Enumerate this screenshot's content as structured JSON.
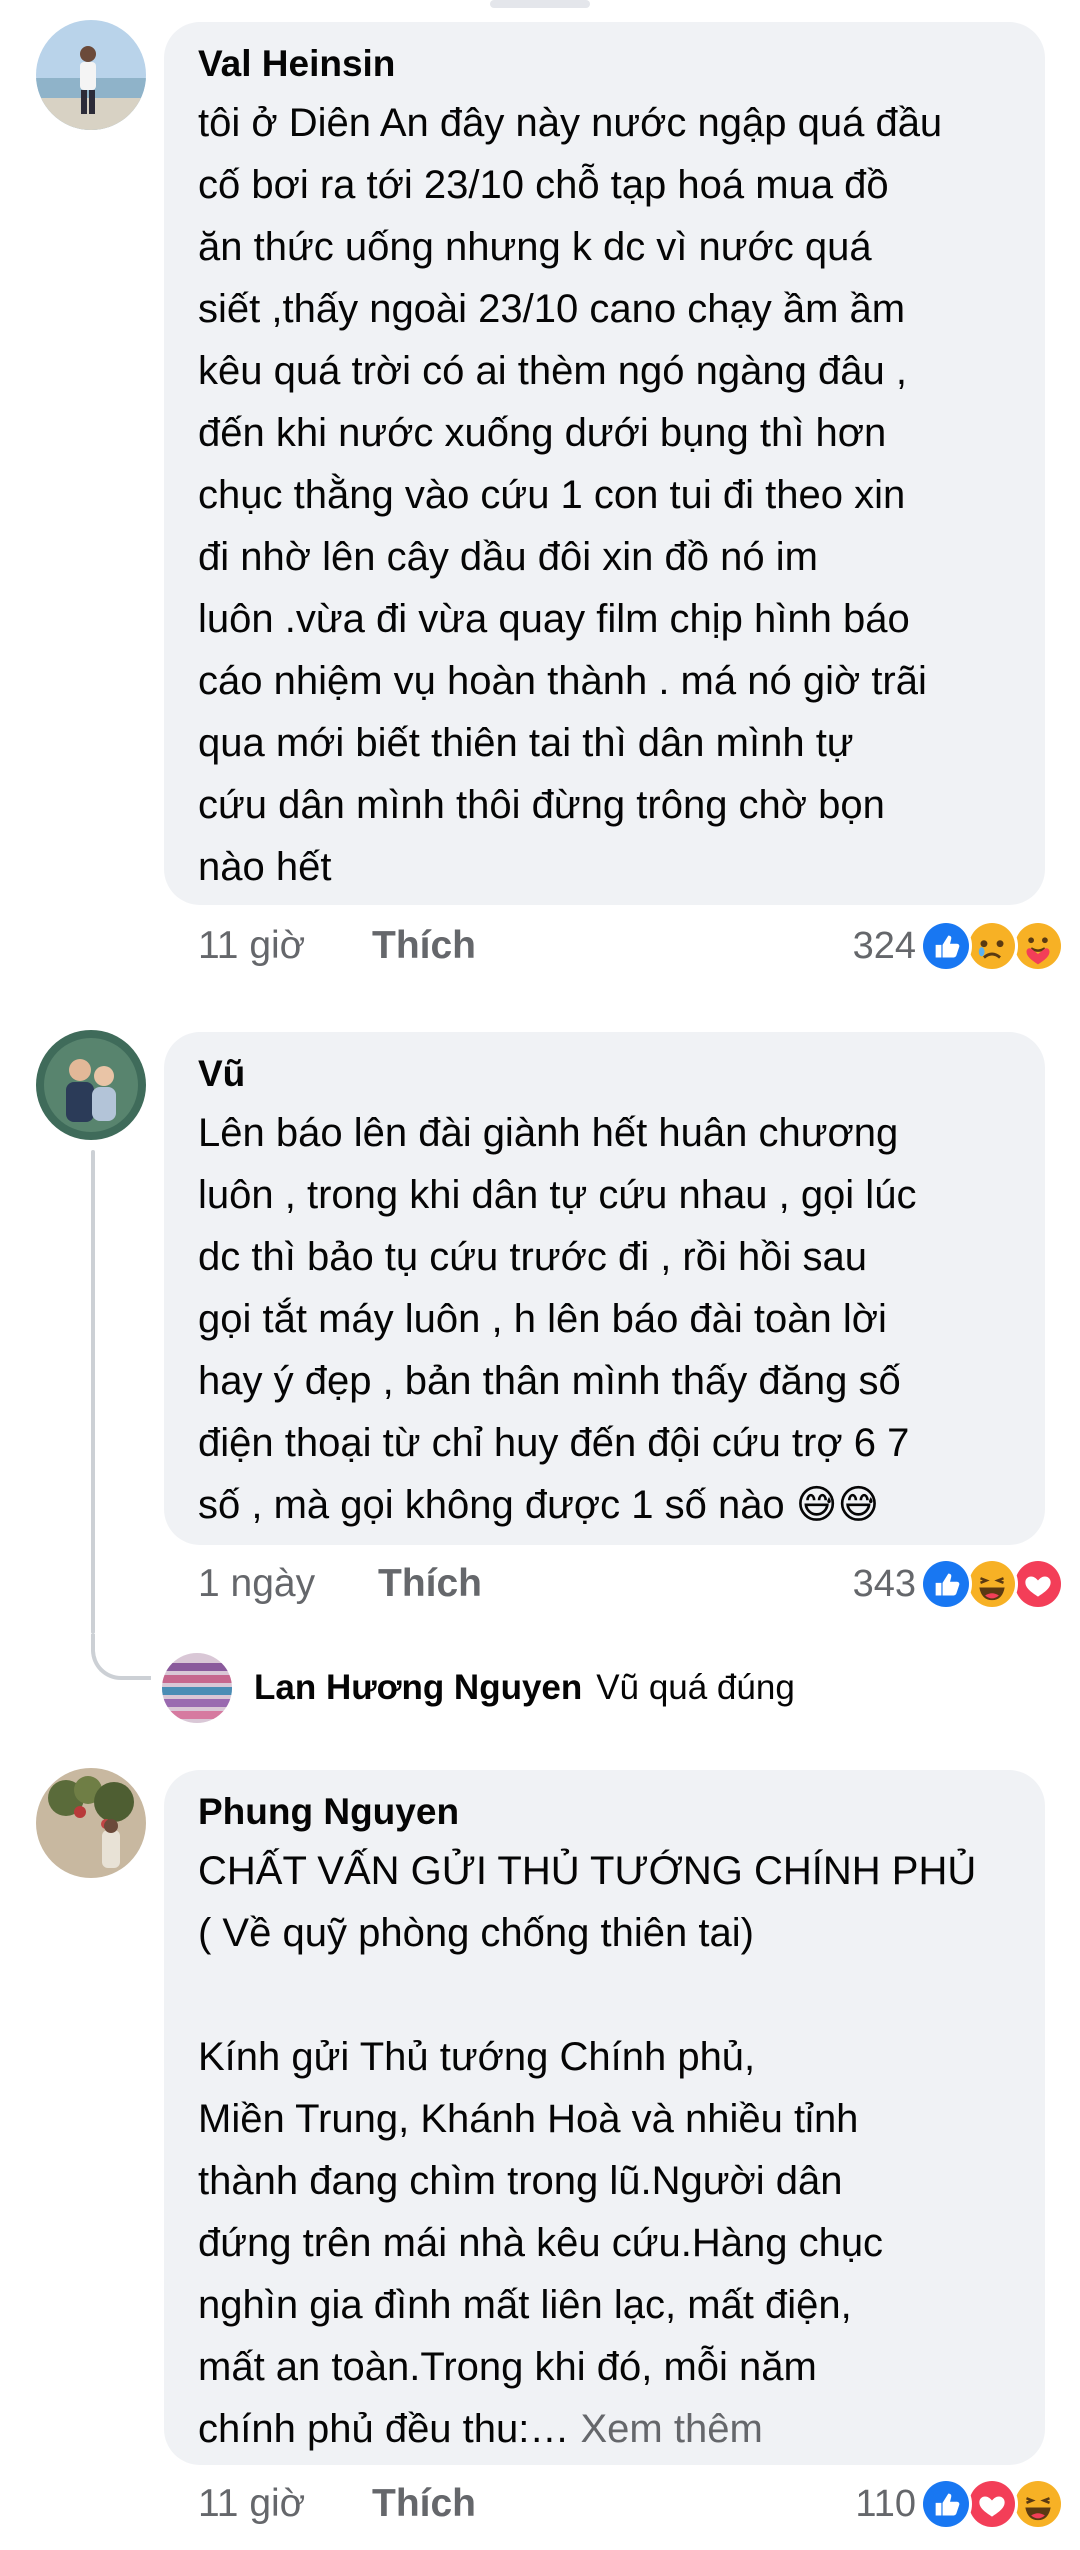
{
  "comments": [
    {
      "author": "Val Heinsin",
      "text": "tôi ở Diên An đây này nước ngập quá đầu\ncố bơi ra tới 23/10 chỗ tạp hoá mua đồ\năn thức uống nhưng k dc vì nước quá\nsiết ,thấy ngoài 23/10 cano chạy ầm ầm\nkêu quá trời có ai thèm ngó ngàng đâu ,\nđến khi nước xuống dưới bụng thì hơn\nchục thằng vào cứu 1 con tui đi theo xin\nđi nhờ lên cây dầu đôi xin đồ nó im\nluôn .vừa đi vừa quay film chịp hình báo\ncáo nhiệm vụ hoàn thành . má nó giờ trãi\nqua mới biết thiên tai thì dân mình tự\ncứu dân mình thôi đừng trông chờ bọn\nnào hết",
      "time": "11 giờ",
      "like_label": "Thích",
      "reaction_count": "324",
      "reactions": [
        "like-icon",
        "sad-icon",
        "care-icon"
      ]
    },
    {
      "author": "Vũ",
      "text": "Lên báo lên đài giành hết huân chương\nluôn , trong khi dân tự cứu nhau , gọi lúc\ndc thì bảo tụ cứu trước đi , rồi hồi sau\ngọi tắt máy luôn , h lên báo đài toàn lời\nhay ý đẹp , bản thân mình thấy đăng số\nđiện thoại từ chỉ huy đến đội cứu trợ 6 7\nsố , mà gọi không được 1 số nào 😅😅",
      "time": "1 ngày",
      "like_label": "Thích",
      "reaction_count": "343",
      "reactions": [
        "like-icon",
        "haha-icon",
        "love-icon"
      ],
      "reply": {
        "author": "Lan Hương Nguyen",
        "text": "Vũ quá đúng"
      }
    },
    {
      "author": "Phung Nguyen",
      "text": "CHẤT VẤN GỬI THỦ TƯỚNG CHÍNH PHỦ\n( Về quỹ phòng chống thiên tai)\n\nKính gửi Thủ tướng Chính phủ,\nMiền Trung, Khánh Hoà và nhiều tỉnh\nthành đang chìm trong lũ.Người dân\nđứng trên mái nhà kêu cứu.Hàng chục\nnghìn gia đình mất liên lạc, mất điện,\nmất an toàn.Trong khi đó, mỗi năm\nchính phủ đều thu:…",
      "see_more": " Xem thêm",
      "time": "11 giờ",
      "like_label": "Thích",
      "reaction_count": "110",
      "reactions": [
        "like-icon",
        "love-icon",
        "haha-icon"
      ]
    }
  ],
  "colors": {
    "bubble_bg": "#f0f2f5",
    "secondary_text": "#65676b",
    "like_blue": "#1877f2",
    "love_red": "#f33e58",
    "emoji_yellow": "#f7b125"
  }
}
